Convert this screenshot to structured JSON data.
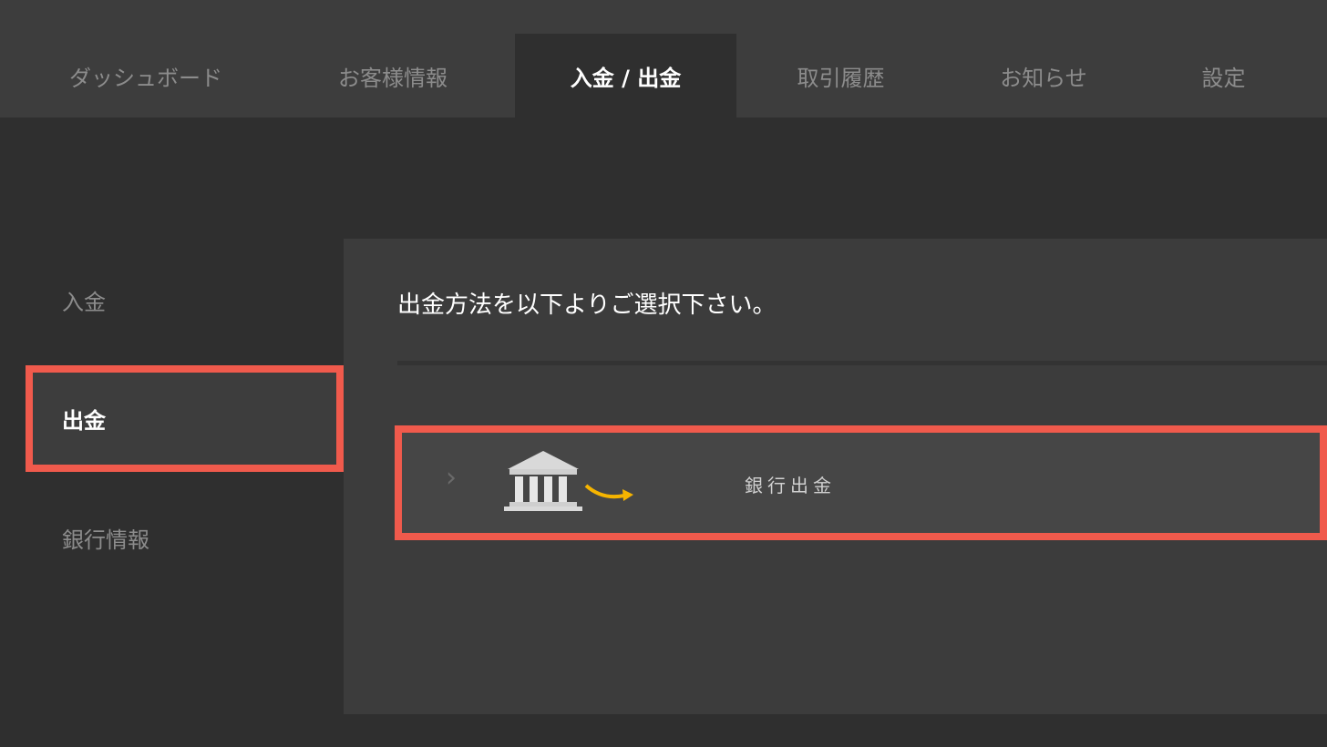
{
  "nav": {
    "tabs": [
      {
        "label": "ダッシュボード"
      },
      {
        "label": "お客様情報"
      },
      {
        "label": "入金 / 出金"
      },
      {
        "label": "取引履歴"
      },
      {
        "label": "お知らせ"
      },
      {
        "label": "設定"
      }
    ],
    "active_tab": "入金 / 出金"
  },
  "sidebar": {
    "items": [
      {
        "label": "入金"
      },
      {
        "label": "出金"
      },
      {
        "label": "銀行情報"
      }
    ],
    "selected": "出金"
  },
  "main": {
    "title": "出金方法を以下よりご選択下さい。",
    "methods": [
      {
        "label": "銀行出金",
        "icon": "bank-transfer-icon"
      }
    ]
  },
  "colors": {
    "highlight": "#f05a4c",
    "arrow_accent": "#f5b400",
    "topbar": "#3d3d3d",
    "background": "#2f2f2f"
  }
}
